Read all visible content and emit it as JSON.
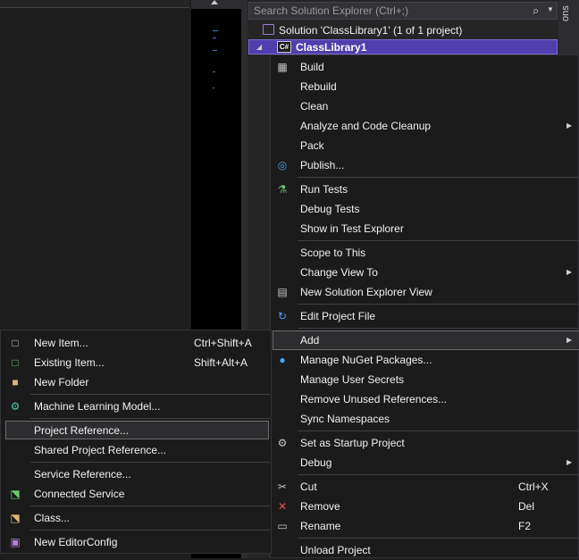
{
  "solution_explorer": {
    "search_placeholder": "Search Solution Explorer (Ctrl+;)",
    "solution_label": "Solution 'ClassLibrary1' (1 of 1 project)",
    "project_label": "ClassLibrary1",
    "project_badge": "C#"
  },
  "right_strip": {
    "text": "ons"
  },
  "context_menu": {
    "items": [
      {
        "label": "Build",
        "icon": "build-icon"
      },
      {
        "label": "Rebuild"
      },
      {
        "label": "Clean"
      },
      {
        "label": "Analyze and Code Cleanup",
        "submenu": true
      },
      {
        "label": "Pack"
      },
      {
        "label": "Publish...",
        "icon": "globe-icon"
      },
      {
        "label": "Run Tests",
        "icon": "test-flask-icon"
      },
      {
        "label": "Debug Tests"
      },
      {
        "label": "Show in Test Explorer"
      },
      {
        "label": "Scope to This"
      },
      {
        "label": "Change View To",
        "submenu": true
      },
      {
        "label": "New Solution Explorer View",
        "icon": "new-view-icon"
      },
      {
        "label": "Edit Project File",
        "icon": "refresh-arrow-icon"
      },
      {
        "label": "Add",
        "submenu": true,
        "highlighted": true
      },
      {
        "label": "Manage NuGet Packages...",
        "icon": "nuget-icon"
      },
      {
        "label": "Manage User Secrets"
      },
      {
        "label": "Remove Unused References..."
      },
      {
        "label": "Sync Namespaces"
      },
      {
        "label": "Set as Startup Project",
        "icon": "gear-icon"
      },
      {
        "label": "Debug",
        "submenu": true
      },
      {
        "label": "Cut",
        "icon": "scissors-icon",
        "shortcut": "Ctrl+X"
      },
      {
        "label": "Remove",
        "icon": "x-icon",
        "shortcut": "Del"
      },
      {
        "label": "Rename",
        "icon": "rename-icon",
        "shortcut": "F2"
      },
      {
        "label": "Unload Project"
      }
    ]
  },
  "add_submenu": {
    "items": [
      {
        "label": "New Item...",
        "icon": "new-item-icon",
        "shortcut": "Ctrl+Shift+A"
      },
      {
        "label": "Existing Item...",
        "icon": "existing-item-icon",
        "shortcut": "Shift+Alt+A"
      },
      {
        "label": "New Folder",
        "icon": "folder-icon"
      },
      {
        "label": "Machine Learning Model...",
        "icon": "ml-model-icon"
      },
      {
        "label": "Project Reference...",
        "highlighted": true
      },
      {
        "label": "Shared Project Reference..."
      },
      {
        "label": "Service Reference..."
      },
      {
        "label": "Connected Service",
        "icon": "connected-service-icon"
      },
      {
        "label": "Class...",
        "icon": "class-icon"
      },
      {
        "label": "New EditorConfig",
        "icon": "editorconfig-icon"
      }
    ]
  },
  "colors": {
    "accent": "#4f3eab",
    "menu_bg": "#1b1b1c",
    "highlight": "#2d2d30"
  }
}
